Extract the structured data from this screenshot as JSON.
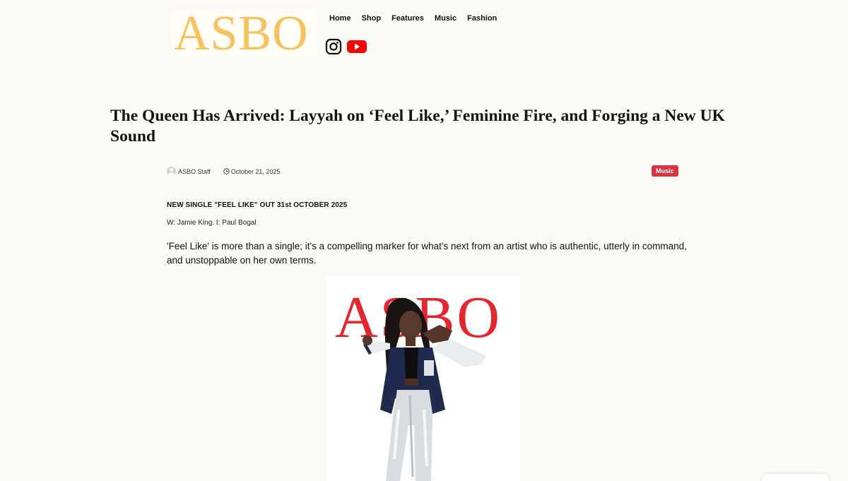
{
  "header": {
    "logo_text": "ASBO",
    "nav": [
      "Home",
      "Shop",
      "Features",
      "Music",
      "Fashion"
    ],
    "social": [
      "instagram-icon",
      "youtube-icon"
    ]
  },
  "article": {
    "title": "The Queen Has Arrived: Layyah on ‘Feel Like,’ Feminine Fire, and Forging a New UK Sound",
    "author": "ASBO Staff",
    "date": "October 21, 2025",
    "category": "Music",
    "kicker": "NEW SINGLE \"FEEL LIKE\" OUT 31st OCTOBER 2025",
    "credits": "W: Jamie King. I: Paul Bogal",
    "standfirst": "'Feel Like' is more than a single; it's a compelling marker for what's next from an artist who is authentic, utterly in command, and unstoppable on her own terms.",
    "image_logo_text": "ASBO"
  },
  "colors": {
    "logo": "#f7c35f",
    "badge": "#d6343e",
    "image_logo": "#e4262f",
    "background": "#fbfaf7"
  }
}
